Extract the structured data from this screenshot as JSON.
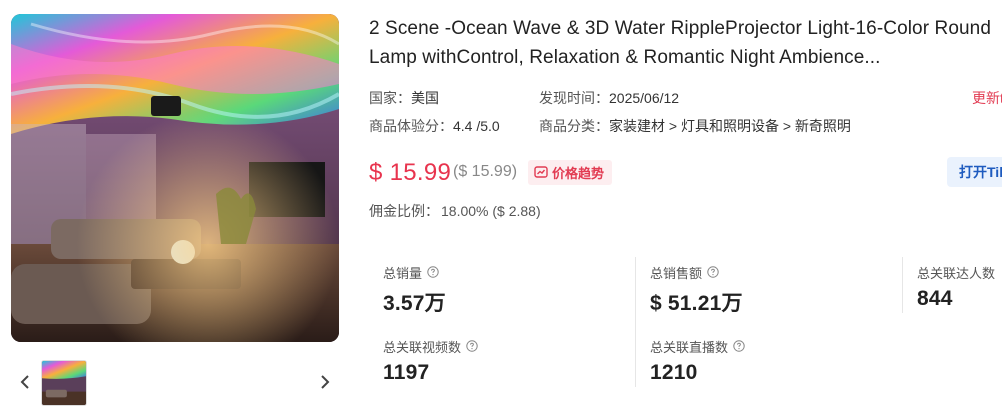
{
  "product": {
    "title": "2 Scene -Ocean Wave & 3D Water RippleProjector Light-16-Color Round Lamp withControl, Relaxation & Romantic Night Ambience...",
    "country_label": "国家：",
    "country_value": "美国",
    "found_time_label": "发现时间：",
    "found_time_value": "2025/06/12",
    "update_link": "更新t",
    "rating_label": "商品体验分：",
    "rating_value": "4.4 /5.0",
    "category_label": "商品分类：",
    "category_value": "家装建材 > 灯具和照明设备 > 新奇照明"
  },
  "pricing": {
    "price": "$ 15.99",
    "original_price": "($ 15.99)",
    "trend_label": "价格趋势",
    "open_button": "打开Tik",
    "commission_label": "佣金比例：",
    "commission_value": "18.00% ($ 2.88)"
  },
  "stats": [
    {
      "label": "总销量",
      "value": "3.57万"
    },
    {
      "label": "总销售额",
      "value": "$ 51.21万"
    },
    {
      "label": "总关联达人数",
      "value": "844"
    },
    {
      "label": "总关联视频数",
      "value": "1197"
    },
    {
      "label": "总关联直播数",
      "value": "1210"
    }
  ],
  "icons": {
    "trend": "chart-icon",
    "help": "question-circle-icon",
    "prev": "chevron-left-icon",
    "next": "chevron-right-icon"
  },
  "colors": {
    "accent_red": "#e8344e",
    "link_blue": "#1e5bbf"
  }
}
